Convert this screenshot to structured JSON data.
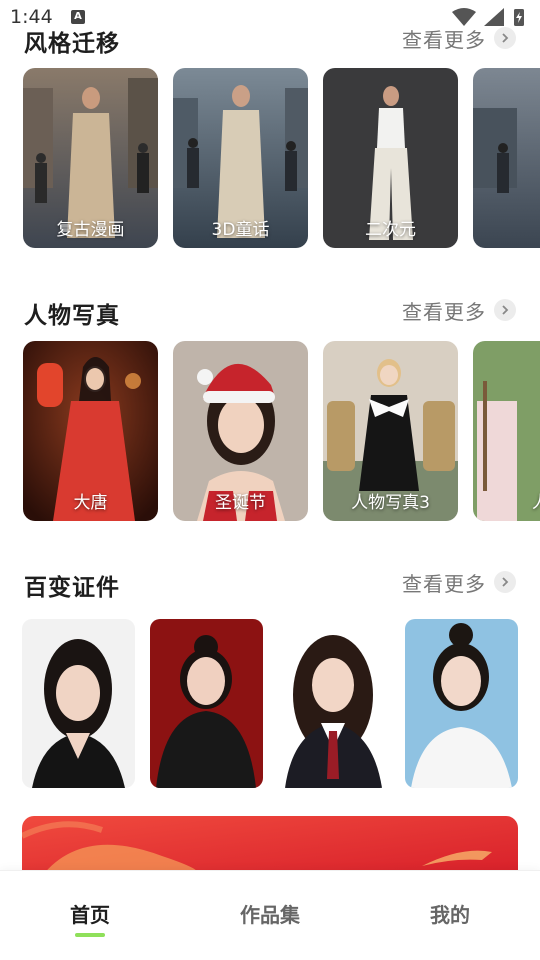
{
  "status_bar": {
    "time": "1:44",
    "notification_badge": "A"
  },
  "sections": [
    {
      "title": "风格迁移",
      "more": "查看更多",
      "cards": [
        {
          "label": "复古漫画"
        },
        {
          "label": "3D童话"
        },
        {
          "label": "二次元"
        },
        {
          "label": ""
        }
      ]
    },
    {
      "title": "人物写真",
      "more": "查看更多",
      "cards": [
        {
          "label": "大唐"
        },
        {
          "label": "圣诞节"
        },
        {
          "label": "人物写真3"
        },
        {
          "label": "人"
        }
      ]
    },
    {
      "title": "百变证件",
      "more": "查看更多",
      "cards": [
        {},
        {},
        {},
        {}
      ]
    }
  ],
  "bottom_nav": {
    "items": [
      {
        "label": "首页"
      },
      {
        "label": "作品集"
      },
      {
        "label": "我的"
      }
    ]
  },
  "colors": {
    "accent": "#8fe05a",
    "banner": "#e8302f"
  },
  "icons": [
    "wifi-icon",
    "signal-icon",
    "battery-icon",
    "chevron-right-icon"
  ]
}
